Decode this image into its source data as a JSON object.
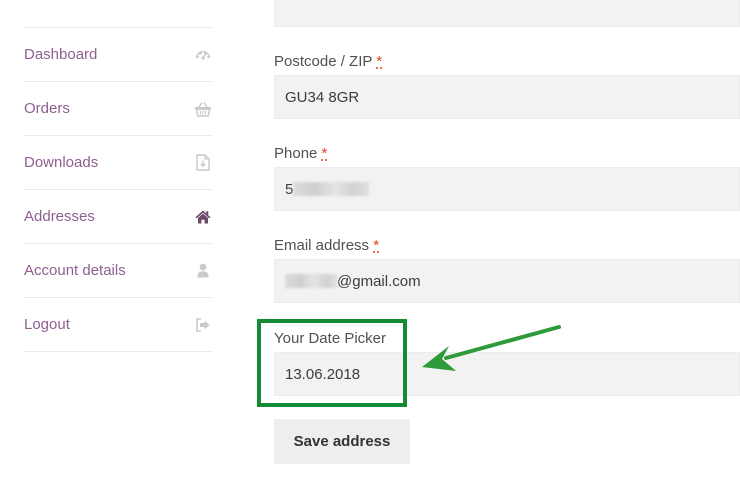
{
  "nav": {
    "items": [
      {
        "label": "Dashboard",
        "icon": "dashboard-icon",
        "active": false
      },
      {
        "label": "Orders",
        "icon": "basket-icon",
        "active": false
      },
      {
        "label": "Downloads",
        "icon": "file-download-icon",
        "active": false
      },
      {
        "label": "Addresses",
        "icon": "home-icon",
        "active": true
      },
      {
        "label": "Account details",
        "icon": "user-icon",
        "active": false
      },
      {
        "label": "Logout",
        "icon": "sign-out-icon",
        "active": false
      }
    ],
    "link_color": "#8f5f8f"
  },
  "form": {
    "postcode": {
      "label": "Postcode / ZIP ",
      "required_mark": "*",
      "value": "GU34 8GR"
    },
    "phone": {
      "label": "Phone ",
      "required_mark": "*",
      "value_visible": "5"
    },
    "email": {
      "label": "Email address ",
      "required_mark": "*",
      "value_visible": "@gmail.com"
    },
    "date_picker": {
      "label": "Your Date Picker",
      "value": "13.06.2018"
    }
  },
  "save_button": {
    "label": "Save address"
  },
  "annotation": {
    "highlight_color": "#138a36",
    "arrow_color": "#2e9a3a"
  }
}
